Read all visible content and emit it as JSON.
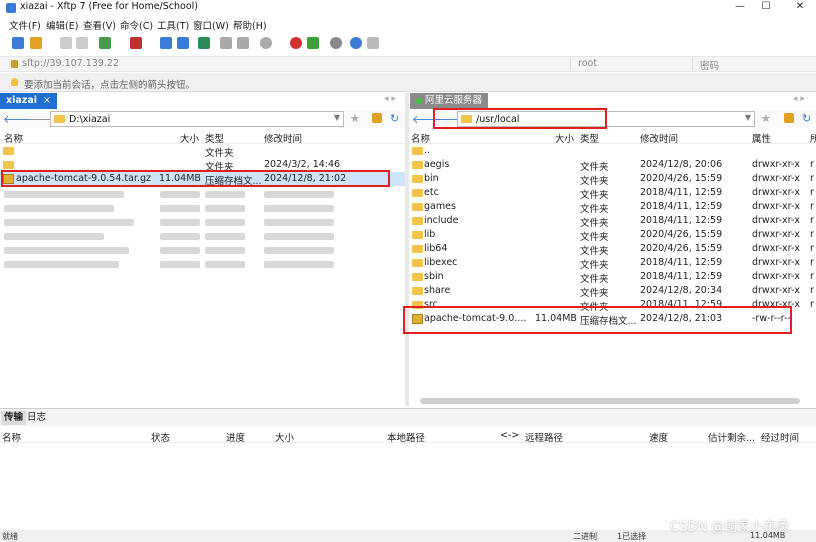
{
  "window": {
    "title": "xiazai - Xftp 7 (Free for Home/School)"
  },
  "menu": [
    "文件(F)",
    "编辑(E)",
    "查看(V)",
    "命令(C)",
    "工具(T)",
    "窗口(W)",
    "帮助(H)"
  ],
  "address": {
    "host": "sftp://39.107.139.22",
    "user_placeholder": "root",
    "password_placeholder": "密码"
  },
  "hint": "要添加当前会话，点击左侧的箭头按钮。",
  "local": {
    "tab_label": "xiazai",
    "tab_close": "×",
    "path": "D:\\xiazai",
    "columns": {
      "name": "名称",
      "size": "大小",
      "type": "类型",
      "modified": "修改时间"
    },
    "rows": [
      {
        "name": "",
        "size": "",
        "type": "文件夹",
        "modified": ""
      },
      {
        "name": "",
        "size": "",
        "type": "文件夹",
        "modified": "2024/3/2, 14:46"
      },
      {
        "name": "apache-tomcat-9.0.54.tar.gz",
        "size": "11.04MB",
        "type": "压缩存档文...",
        "modified": "2024/12/8, 21:02"
      }
    ]
  },
  "remote": {
    "tab_label": "阿里云服务器",
    "path": "/usr/local",
    "columns": {
      "name": "名称",
      "size": "大小",
      "type": "类型",
      "modified": "修改时间",
      "attr": "属性",
      "owner": "所"
    },
    "rows": [
      {
        "name": "..",
        "size": "",
        "type": "",
        "modified": "",
        "attr": "",
        "owner": ""
      },
      {
        "name": "aegis",
        "size": "",
        "type": "文件夹",
        "modified": "2024/12/8, 20:06",
        "attr": "drwxr-xr-x",
        "owner": "r"
      },
      {
        "name": "bin",
        "size": "",
        "type": "文件夹",
        "modified": "2020/4/26, 15:59",
        "attr": "drwxr-xr-x",
        "owner": "r"
      },
      {
        "name": "etc",
        "size": "",
        "type": "文件夹",
        "modified": "2018/4/11, 12:59",
        "attr": "drwxr-xr-x",
        "owner": "r"
      },
      {
        "name": "games",
        "size": "",
        "type": "文件夹",
        "modified": "2018/4/11, 12:59",
        "attr": "drwxr-xr-x",
        "owner": "r"
      },
      {
        "name": "include",
        "size": "",
        "type": "文件夹",
        "modified": "2018/4/11, 12:59",
        "attr": "drwxr-xr-x",
        "owner": "r"
      },
      {
        "name": "lib",
        "size": "",
        "type": "文件夹",
        "modified": "2020/4/26, 15:59",
        "attr": "drwxr-xr-x",
        "owner": "r"
      },
      {
        "name": "lib64",
        "size": "",
        "type": "文件夹",
        "modified": "2020/4/26, 15:59",
        "attr": "drwxr-xr-x",
        "owner": "r"
      },
      {
        "name": "libexec",
        "size": "",
        "type": "文件夹",
        "modified": "2018/4/11, 12:59",
        "attr": "drwxr-xr-x",
        "owner": "r"
      },
      {
        "name": "sbin",
        "size": "",
        "type": "文件夹",
        "modified": "2018/4/11, 12:59",
        "attr": "drwxr-xr-x",
        "owner": "r"
      },
      {
        "name": "share",
        "size": "",
        "type": "文件夹",
        "modified": "2024/12/8, 20:34",
        "attr": "drwxr-xr-x",
        "owner": "r"
      },
      {
        "name": "src",
        "size": "",
        "type": "文件夹",
        "modified": "2018/4/11, 12:59",
        "attr": "drwxr-xr-x",
        "owner": "r"
      },
      {
        "name": "apache-tomcat-9.0....",
        "size": "11.04MB",
        "type": "压缩存档文...",
        "modified": "2024/12/8, 21:03",
        "attr": "-rw-r--r--",
        "owner": ""
      }
    ]
  },
  "transfer": {
    "tabs": [
      "传输",
      "日志"
    ],
    "columns": [
      "名称",
      "状态",
      "进度",
      "大小",
      "本地路径",
      "<->",
      "远程路径",
      "速度",
      "估计剩余...",
      "经过时间"
    ]
  },
  "status": {
    "left": "就绪",
    "mode": "二进制",
    "selected": "1已选择",
    "size": "11.04MB"
  },
  "watermark": "CSDN @谢家小布柔",
  "colors": {
    "accent": "#1e6fd1",
    "highlight": "#e02020",
    "folder": "#f2c54a",
    "selection": "#cde4fb"
  }
}
